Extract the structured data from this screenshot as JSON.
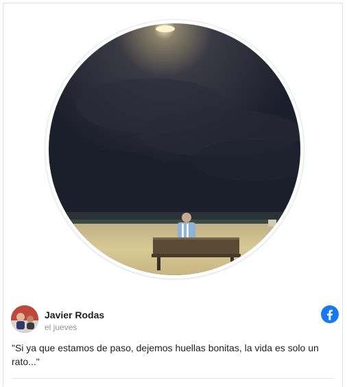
{
  "post": {
    "author_name": "Javier Rodas",
    "author_subtitle": "el jueves",
    "text": "\"Si ya que estamos de paso, dejemos huellas bonitas, la vida es solo un rato...\""
  },
  "icons": {
    "platform": "facebook-icon"
  },
  "colors": {
    "facebook_blue": "#1877f2",
    "name_text": "#1c1e21",
    "subtitle_text": "#90949c",
    "sky": "#1d2230",
    "sand": "#d8c89a"
  }
}
